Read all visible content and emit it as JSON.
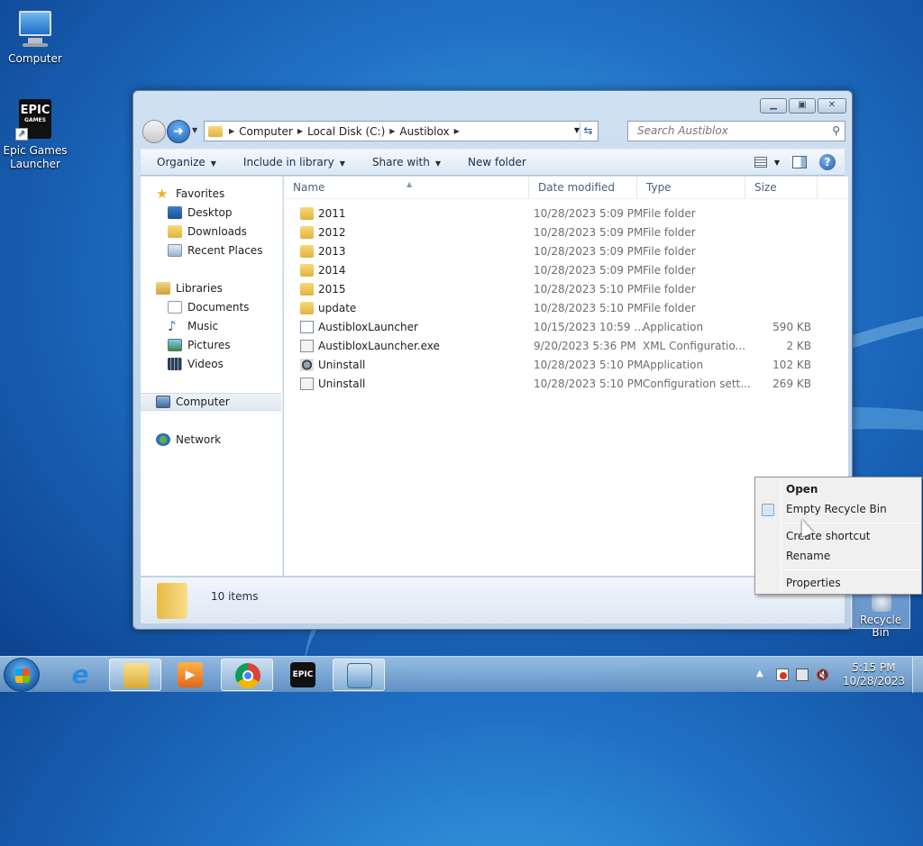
{
  "desktop": {
    "icons": [
      {
        "label": "Computer"
      },
      {
        "label": "Epic Games Launcher"
      },
      {
        "label": "Recycle Bin"
      }
    ]
  },
  "explorer": {
    "breadcrumb": [
      "Computer",
      "Local Disk (C:)",
      "Austiblox"
    ],
    "search_placeholder": "Search Austiblox",
    "toolbar": {
      "organize": "Organize",
      "include_in_library": "Include in library",
      "share_with": "Share with",
      "new_folder": "New folder"
    },
    "nav": {
      "favorites": "Favorites",
      "favorites_items": [
        "Desktop",
        "Downloads",
        "Recent Places"
      ],
      "libraries": "Libraries",
      "libraries_items": [
        "Documents",
        "Music",
        "Pictures",
        "Videos"
      ],
      "computer": "Computer",
      "network": "Network"
    },
    "columns": {
      "name": "Name",
      "date": "Date modified",
      "type": "Type",
      "size": "Size"
    },
    "files": [
      {
        "name": "2011",
        "date": "10/28/2023 5:09 PM",
        "type": "File folder",
        "size": "",
        "icon": "folder-icon"
      },
      {
        "name": "2012",
        "date": "10/28/2023 5:09 PM",
        "type": "File folder",
        "size": "",
        "icon": "folder-icon"
      },
      {
        "name": "2013",
        "date": "10/28/2023 5:09 PM",
        "type": "File folder",
        "size": "",
        "icon": "folder-icon"
      },
      {
        "name": "2014",
        "date": "10/28/2023 5:09 PM",
        "type": "File folder",
        "size": "",
        "icon": "folder-icon"
      },
      {
        "name": "2015",
        "date": "10/28/2023 5:10 PM",
        "type": "File folder",
        "size": "",
        "icon": "folder-icon"
      },
      {
        "name": "update",
        "date": "10/28/2023 5:10 PM",
        "type": "File folder",
        "size": "",
        "icon": "folder-icon"
      },
      {
        "name": "AustibloxLauncher",
        "date": "10/15/2023 10:59 ...",
        "type": "Application",
        "size": "590 KB",
        "icon": "application-icon"
      },
      {
        "name": "AustibloxLauncher.exe",
        "date": "9/20/2023 5:36 PM",
        "type": "XML Configuratio...",
        "size": "2 KB",
        "icon": "xml-file-icon"
      },
      {
        "name": "Uninstall",
        "date": "10/28/2023 5:10 PM",
        "type": "Application",
        "size": "102 KB",
        "icon": "uninstall-app-icon"
      },
      {
        "name": "Uninstall",
        "date": "10/28/2023 5:10 PM",
        "type": "Configuration sett...",
        "size": "269 KB",
        "icon": "config-file-icon"
      }
    ],
    "status": {
      "item_count": "10 items"
    }
  },
  "context_menu": {
    "items": [
      "Open",
      "Empty Recycle Bin",
      "Create shortcut",
      "Rename",
      "Properties"
    ]
  },
  "taskbar": {
    "apps": [
      "windows-explorer-icon",
      "internet-explorer-icon",
      "file-explorer-icon",
      "media-player-icon",
      "chrome-icon",
      "epic-games-icon",
      "control-panel-icon"
    ],
    "clock": {
      "time": "5:15 PM",
      "date": "10/28/2023"
    }
  }
}
